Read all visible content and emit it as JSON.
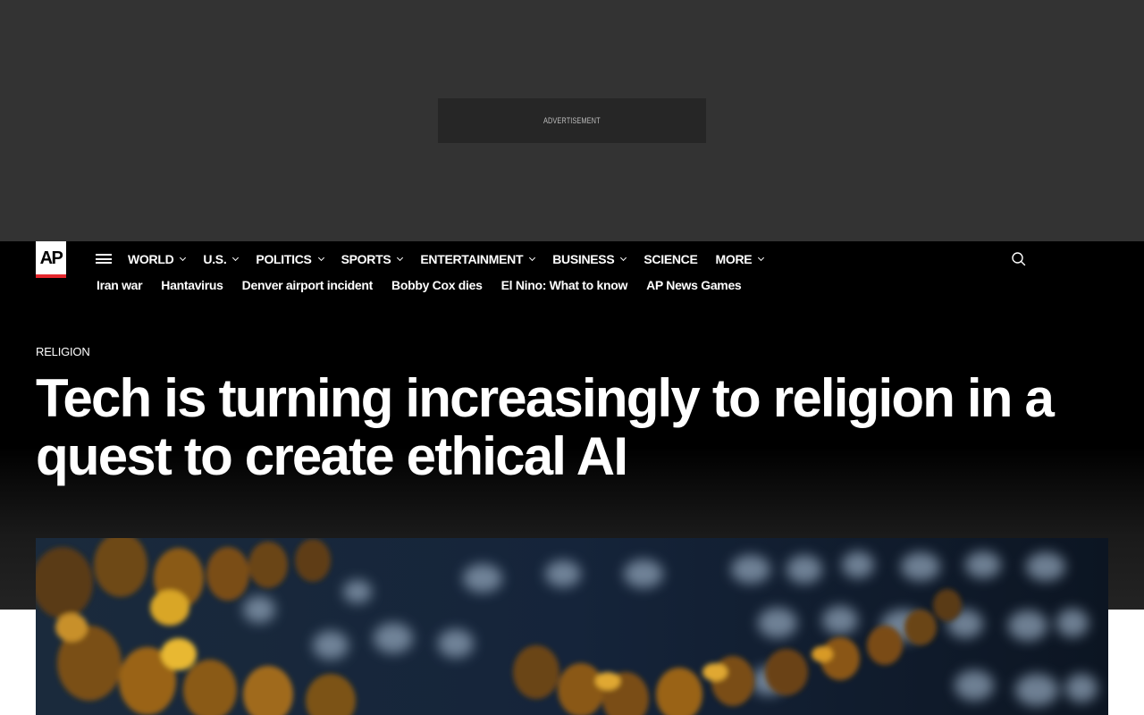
{
  "advertisement": {
    "label": "ADVERTISEMENT"
  },
  "header": {
    "logo_text": "AP",
    "main_nav": [
      {
        "label": "WORLD",
        "has_dropdown": true
      },
      {
        "label": "U.S.",
        "has_dropdown": true
      },
      {
        "label": "POLITICS",
        "has_dropdown": true
      },
      {
        "label": "SPORTS",
        "has_dropdown": true
      },
      {
        "label": "ENTERTAINMENT",
        "has_dropdown": true
      },
      {
        "label": "BUSINESS",
        "has_dropdown": true
      },
      {
        "label": "SCIENCE",
        "has_dropdown": false
      },
      {
        "label": "MORE",
        "has_dropdown": true
      }
    ],
    "trending": [
      {
        "label": "Iran war"
      },
      {
        "label": "Hantavirus"
      },
      {
        "label": "Denver airport incident"
      },
      {
        "label": "Bobby Cox dies"
      },
      {
        "label": "El Nino: What to know"
      },
      {
        "label": "AP News Games"
      }
    ],
    "icons": {
      "menu": "hamburger-menu-icon",
      "search": "search-icon",
      "dropdown": "chevron-down-icon"
    }
  },
  "article": {
    "category": "RELIGION",
    "headline": "Tech is turning increasingly to religion in a quest to create ethical AI"
  },
  "colors": {
    "ad_background": "#333333",
    "header_background": "#000000",
    "logo_accent": "#e5272d",
    "text": "#ffffff"
  }
}
